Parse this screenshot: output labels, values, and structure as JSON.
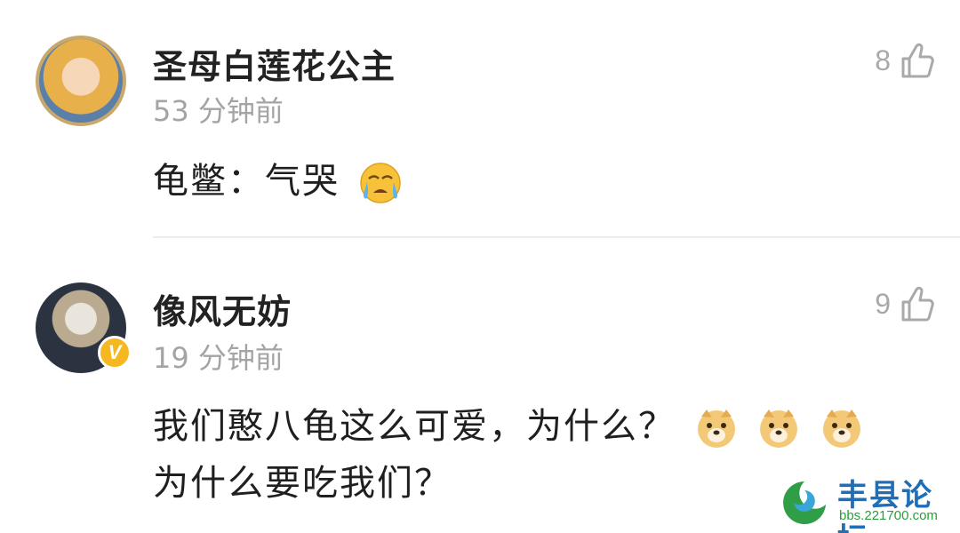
{
  "comments": [
    {
      "username": "圣母白莲花公主",
      "time": "53 分钟前",
      "likes": "8",
      "text": "龟鳖：气哭",
      "emoji": "crying-face"
    },
    {
      "username": "像风无妨",
      "time": "19 分钟前",
      "likes": "9",
      "verified_badge": "V",
      "text_line1": "我们憨八龟这么可爱，为什么？",
      "text_line2": "为什么要吃我们？",
      "emoji": "doge"
    }
  ],
  "watermark": {
    "title": "丰县论坛",
    "url": "bbs.221700.com"
  },
  "colors": {
    "like_gray": "#a9a9a9",
    "time_gray": "#a4a4a4",
    "verified_yellow": "#f5b820"
  }
}
